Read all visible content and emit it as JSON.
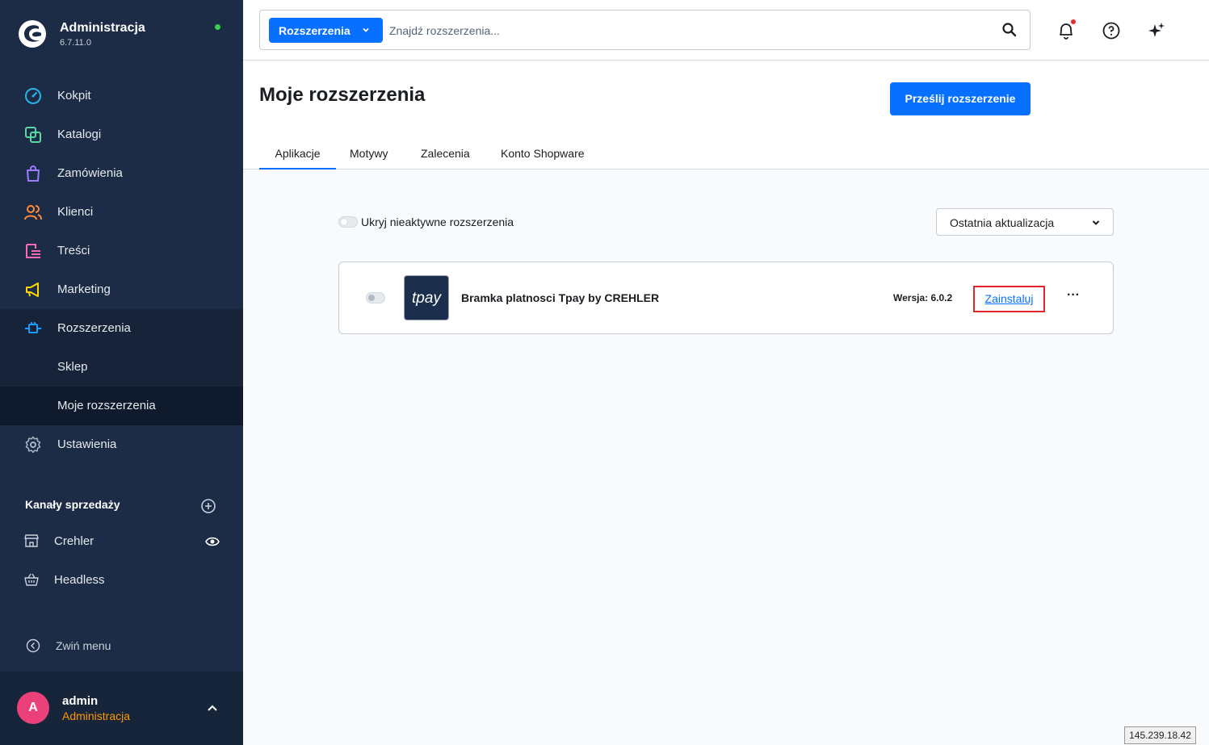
{
  "brand": {
    "title": "Administracja",
    "version": "6.7.11.0",
    "status_color": "#37d046"
  },
  "sidebar": {
    "items": [
      {
        "label": "Kokpit",
        "icon": "gauge-icon",
        "color": "#26b5e6"
      },
      {
        "label": "Katalogi",
        "icon": "catalog-icon",
        "color": "#57d9a3"
      },
      {
        "label": "Zamówienia",
        "icon": "shopping-bag-icon",
        "color": "#9c7dff"
      },
      {
        "label": "Klienci",
        "icon": "users-icon",
        "color": "#ff8c3a"
      },
      {
        "label": "Treści",
        "icon": "content-icon",
        "color": "#ff69b4"
      },
      {
        "label": "Marketing",
        "icon": "megaphone-icon",
        "color": "#ffd700"
      },
      {
        "label": "Rozszerzenia",
        "icon": "plug-icon",
        "color": "#189eff"
      },
      {
        "label": "Sklep",
        "icon": ""
      },
      {
        "label": "Moje rozszerzenia",
        "icon": ""
      },
      {
        "label": "Ustawienia",
        "icon": "gear-icon",
        "color": "#a9b6c4"
      }
    ],
    "sales_channels_title": "Kanały sprzedaży",
    "channels": [
      {
        "label": "Crehler",
        "icon": "storefront-icon"
      },
      {
        "label": "Headless",
        "icon": "basket-icon"
      }
    ],
    "collapse_label": "Zwiń menu",
    "user": {
      "initial": "A",
      "name": "admin",
      "role": "Administracja"
    }
  },
  "search": {
    "type_label": "Rozszerzenia",
    "placeholder": "Znajdź rozszerzenia..."
  },
  "header": {
    "title": "Moje rozszerzenia",
    "upload_label": "Prześlij rozszerzenie",
    "tabs": [
      {
        "label": "Aplikacje",
        "active": true
      },
      {
        "label": "Motywy"
      },
      {
        "label": "Zalecenia"
      },
      {
        "label": "Konto Shopware"
      }
    ]
  },
  "content": {
    "hide_inactive_label": "Ukryj nieaktywne rozszerzenia",
    "sort_value": "Ostatnia aktualizacja",
    "extensions": [
      {
        "logo_text": "tpay",
        "name": "Bramka platnosci Tpay by CREHLER",
        "version": "Wersja: 6.0.2",
        "action_label": "Zainstaluj",
        "more_label": "···"
      }
    ]
  },
  "ip_badge": "145.239.18.42",
  "colors": {
    "accent": "#0870ff",
    "sidebar_bg": "#1c2c46",
    "highlight_border": "#e3262b"
  }
}
